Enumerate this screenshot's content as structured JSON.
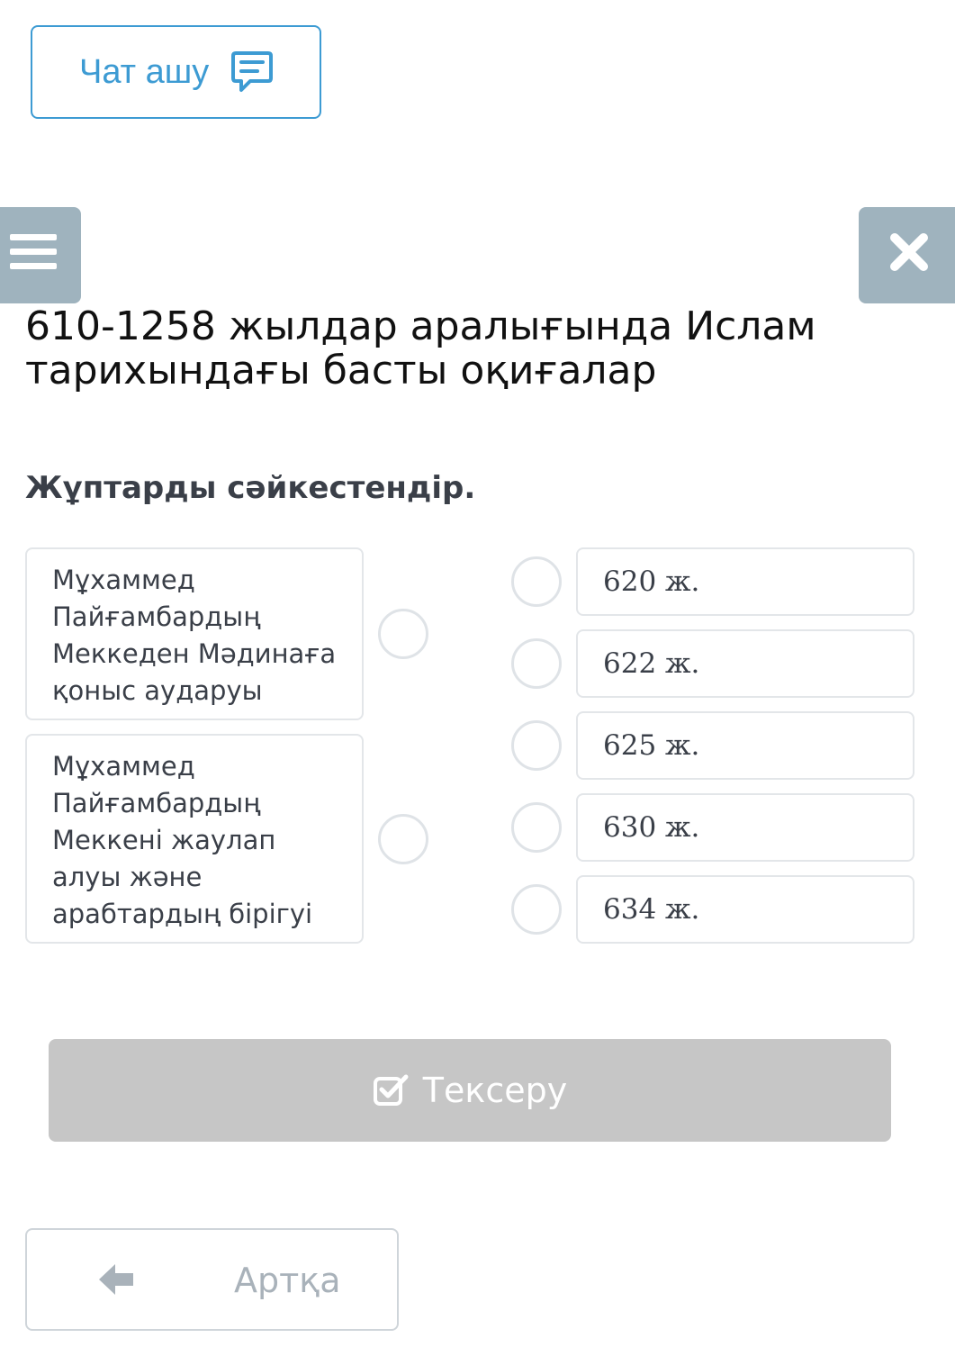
{
  "chat": {
    "label": "Чат ашу",
    "icon": "chat-icon"
  },
  "toolbar": {
    "menu_icon": "hamburger-menu-icon",
    "close_icon": "close-icon"
  },
  "title": "610-1258 жылдар аралығында Ислам тарихындағы басты оқиғалар",
  "instruction": "Жұптарды сәйкестендір.",
  "left_items": [
    {
      "label": "Мұхаммед Пайғамбардың Меккеден Мәдинаға қоныс аударуы"
    },
    {
      "label": "Мұхаммед Пайғамбардың Меккені жаулап алуы және арабтардың бірігуі"
    }
  ],
  "right_items": [
    {
      "label": "620 ж."
    },
    {
      "label": "622 ж."
    },
    {
      "label": "625 ж."
    },
    {
      "label": "630 ж."
    },
    {
      "label": "634 ж."
    }
  ],
  "check_button": {
    "label": "Тексеру",
    "icon": "check-square-icon"
  },
  "back_button": {
    "label": "Артқа",
    "icon": "arrow-left-icon"
  },
  "colors": {
    "accent": "#3d9bd3",
    "sidebar_buttons": "#9fb3be",
    "disabled": "#c6c6c6"
  }
}
